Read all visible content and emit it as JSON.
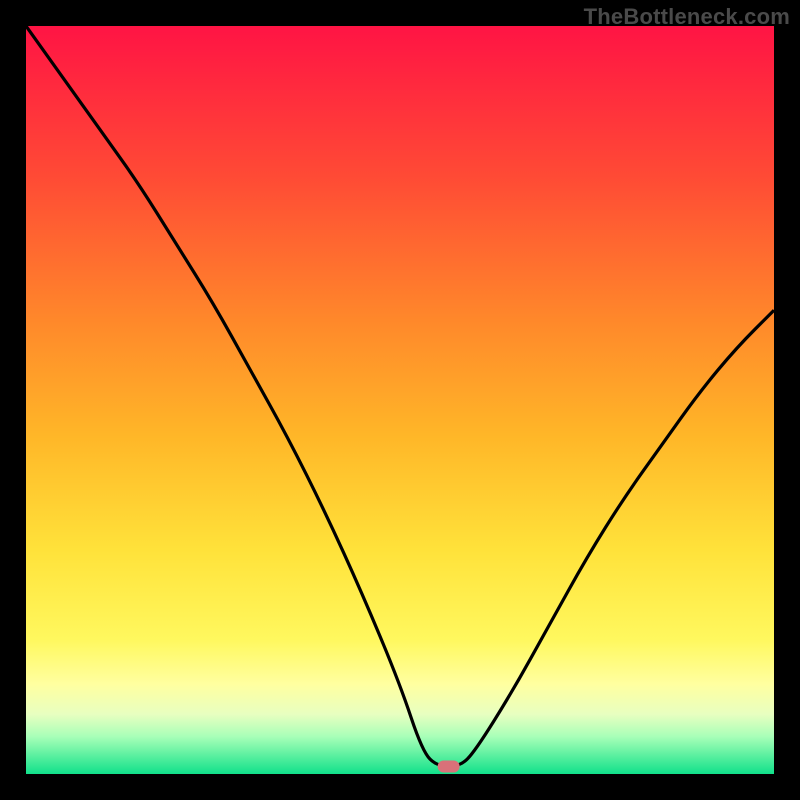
{
  "watermark": "TheBottleneck.com",
  "chart_data": {
    "type": "line",
    "title": "",
    "xlabel": "",
    "ylabel": "",
    "xlim": [
      0,
      100
    ],
    "ylim": [
      0,
      100
    ],
    "series": [
      {
        "name": "curve",
        "x": [
          0,
          5,
          10,
          15,
          20,
          25,
          30,
          35,
          40,
          45,
          50,
          53,
          55,
          58,
          60,
          65,
          70,
          75,
          80,
          85,
          90,
          95,
          100
        ],
        "values": [
          100,
          93,
          86,
          79,
          71,
          63,
          54,
          45,
          35,
          24,
          12,
          3,
          1,
          1,
          3,
          11,
          20,
          29,
          37,
          44,
          51,
          57,
          62
        ]
      }
    ],
    "marker": {
      "x": 56.5,
      "y": 1
    },
    "background_gradient": {
      "stops": [
        {
          "offset": 0.0,
          "color": "#ff1444"
        },
        {
          "offset": 0.2,
          "color": "#ff4a35"
        },
        {
          "offset": 0.4,
          "color": "#ff8a2a"
        },
        {
          "offset": 0.55,
          "color": "#ffb728"
        },
        {
          "offset": 0.7,
          "color": "#ffe23a"
        },
        {
          "offset": 0.82,
          "color": "#fff85e"
        },
        {
          "offset": 0.88,
          "color": "#ffffa0"
        },
        {
          "offset": 0.92,
          "color": "#e8ffc0"
        },
        {
          "offset": 0.95,
          "color": "#a8ffb8"
        },
        {
          "offset": 0.975,
          "color": "#5cf0a0"
        },
        {
          "offset": 1.0,
          "color": "#11e18b"
        }
      ]
    }
  }
}
